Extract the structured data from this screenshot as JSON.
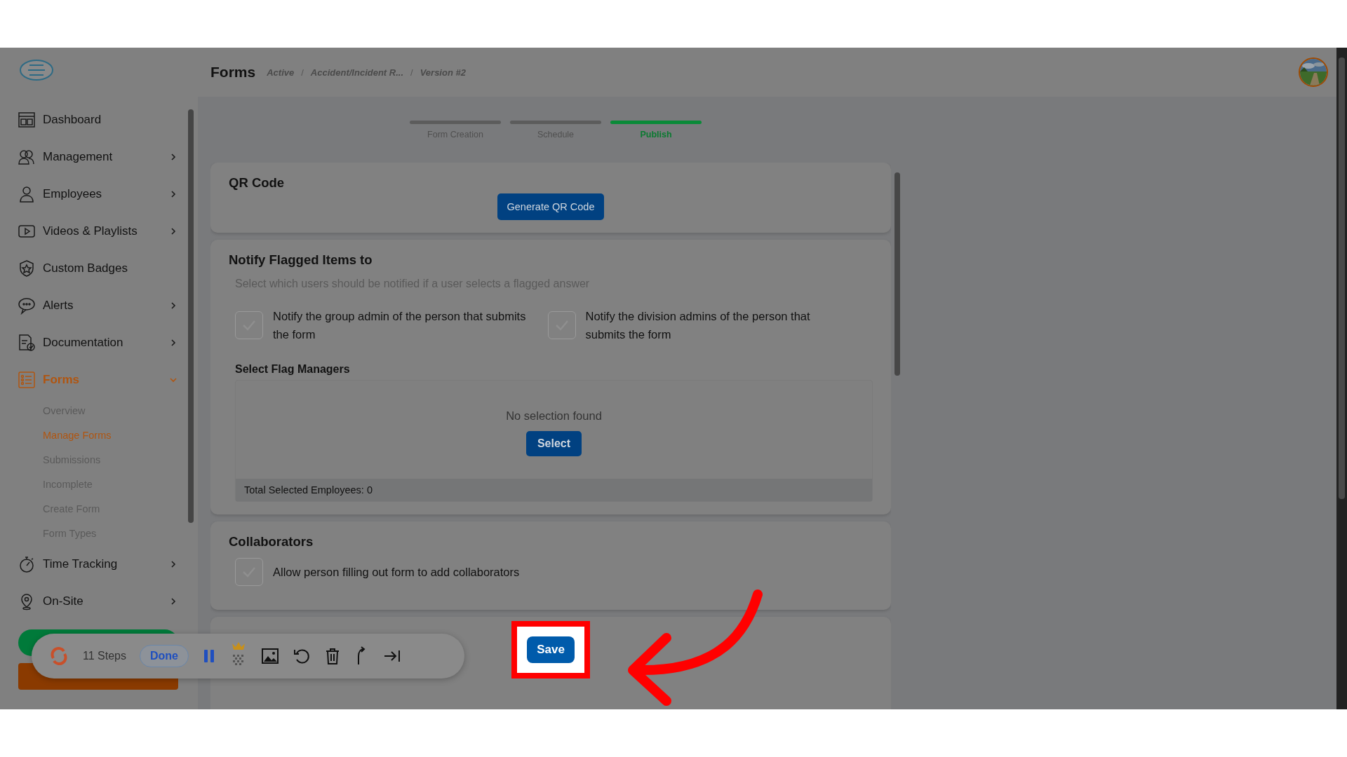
{
  "header": {
    "title": "Forms",
    "breadcrumb": [
      {
        "kind": "link",
        "label": "Active"
      },
      {
        "kind": "separator",
        "label": "/"
      },
      {
        "kind": "link",
        "label": "Accident/Incident R..."
      },
      {
        "kind": "separator",
        "label": "/"
      },
      {
        "kind": "link",
        "label": "Version #2"
      }
    ]
  },
  "sidebar": {
    "items": [
      {
        "label": "Dashboard",
        "kind": "link",
        "expanded": false
      },
      {
        "label": "Management",
        "kind": "group",
        "expanded": false
      },
      {
        "label": "Employees",
        "kind": "group",
        "expanded": false
      },
      {
        "label": "Videos & Playlists",
        "kind": "group",
        "expanded": false
      },
      {
        "label": "Custom Badges",
        "kind": "link",
        "expanded": false
      },
      {
        "label": "Alerts",
        "kind": "group",
        "expanded": false
      },
      {
        "label": "Documentation",
        "kind": "group",
        "expanded": false
      },
      {
        "label": "Forms",
        "kind": "group",
        "expanded": true,
        "children": [
          {
            "label": "Overview",
            "selected": false
          },
          {
            "label": "Manage Forms",
            "selected": true
          },
          {
            "label": "Submissions",
            "selected": false
          },
          {
            "label": "Incomplete",
            "selected": false
          },
          {
            "label": "Create Form",
            "selected": false
          },
          {
            "label": "Form Types",
            "selected": false
          }
        ]
      },
      {
        "label": "Time Tracking",
        "kind": "group",
        "expanded": false
      },
      {
        "label": "On-Site",
        "kind": "group",
        "expanded": false
      }
    ]
  },
  "steps": [
    {
      "label": "Form Creation",
      "selected": false
    },
    {
      "label": "Schedule",
      "selected": false
    },
    {
      "label": "Publish",
      "selected": true
    }
  ],
  "qr_card": {
    "title": "QR Code",
    "button": "Generate QR Code"
  },
  "notify_card": {
    "title": "Notify Flagged Items to",
    "hint": "Select which users should be notified if a user selects a flagged answer",
    "options": [
      {
        "label": "Notify the group admin of the person that submits the form",
        "checked": false
      },
      {
        "label": "Notify the division admins of the person that submits the form",
        "checked": false
      }
    ],
    "managers_title": "Select Flag Managers",
    "empty": "No selection found",
    "select_button": "Select",
    "total": "Total Selected Employees: 0"
  },
  "collaborators_card": {
    "title": "Collaborators",
    "options": [
      {
        "label": "Allow person filling out form to add collaborators",
        "checked": false
      }
    ]
  },
  "save_button": "Save",
  "recorder": {
    "steps": "11 Steps",
    "done": "Done"
  }
}
